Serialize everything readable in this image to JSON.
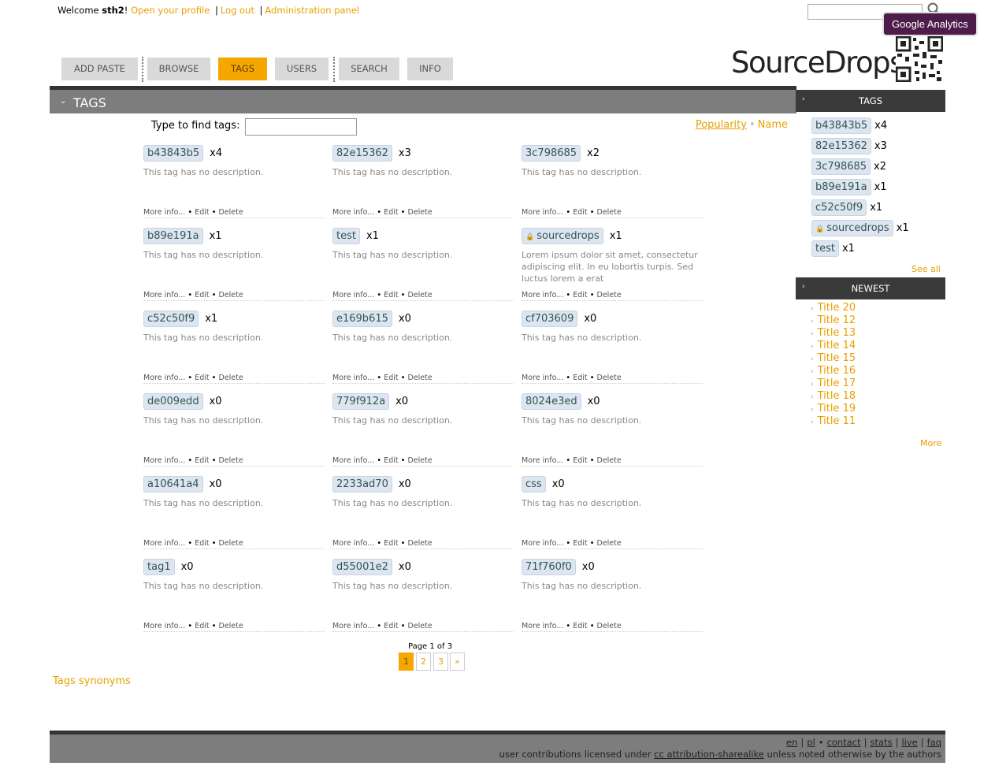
{
  "topbar": {
    "welcome": "Welcome",
    "username": "sth2",
    "exclaim": "!",
    "open_profile": "Open your profile",
    "logout": "Log out",
    "admin": "Administration panel",
    "separator": "|"
  },
  "search": {
    "placeholder": ""
  },
  "ga_badge": "Google Analytics",
  "nav": [
    {
      "label": "ADD PASTE"
    },
    {
      "label": "BROWSE"
    },
    {
      "label": "TAGS",
      "active": true
    },
    {
      "label": "USERS"
    },
    {
      "label": "SEARCH"
    },
    {
      "label": "INFO"
    }
  ],
  "logo": "SourceDrops",
  "main": {
    "title": "TAGS",
    "find_label": "Type to find tags:",
    "sort": {
      "popularity": "Popularity",
      "sep": "•",
      "name": "Name"
    },
    "default_desc": "This tag has no description.",
    "actions": {
      "more": "More info...",
      "edit": "Edit",
      "delete": "Delete",
      "bullet": "•"
    },
    "tags": [
      {
        "name": "b43843b5",
        "count": "x4",
        "desc": "This tag has no description."
      },
      {
        "name": "82e15362",
        "count": "x3",
        "desc": "This tag has no description."
      },
      {
        "name": "3c798685",
        "count": "x2",
        "desc": "This tag has no description."
      },
      {
        "name": "b89e191a",
        "count": "x1",
        "desc": "This tag has no description."
      },
      {
        "name": "test",
        "count": "x1",
        "desc": "This tag has no description."
      },
      {
        "name": "sourcedrops",
        "count": "x1",
        "locked": true,
        "desc": "Lorem ipsum dolor sit amet, consectetur adipiscing elit. In eu lobortis turpis. Sed luctus lorem a erat"
      },
      {
        "name": "c52c50f9",
        "count": "x1",
        "desc": "This tag has no description."
      },
      {
        "name": "e169b615",
        "count": "x0",
        "desc": "This tag has no description."
      },
      {
        "name": "cf703609",
        "count": "x0",
        "desc": "This tag has no description."
      },
      {
        "name": "de009edd",
        "count": "x0",
        "desc": "This tag has no description."
      },
      {
        "name": "779f912a",
        "count": "x0",
        "desc": "This tag has no description."
      },
      {
        "name": "8024e3ed",
        "count": "x0",
        "desc": "This tag has no description."
      },
      {
        "name": "a10641a4",
        "count": "x0",
        "desc": "This tag has no description."
      },
      {
        "name": "2233ad70",
        "count": "x0",
        "desc": "This tag has no description."
      },
      {
        "name": "css",
        "count": "x0",
        "desc": "This tag has no description."
      },
      {
        "name": "tag1",
        "count": "x0",
        "desc": "This tag has no description."
      },
      {
        "name": "d55001e2",
        "count": "x0",
        "desc": "This tag has no description."
      },
      {
        "name": "71f760f0",
        "count": "x0",
        "desc": "This tag has no description."
      }
    ],
    "pagination": {
      "label": "Page 1 of 3",
      "pages": [
        "1",
        "2",
        "3",
        "»"
      ],
      "current": "1"
    },
    "synonyms": "Tags synonyms"
  },
  "sidebar": {
    "tags_title": "TAGS",
    "tags": [
      {
        "name": "b43843b5",
        "count": "x4"
      },
      {
        "name": "82e15362",
        "count": "x3"
      },
      {
        "name": "3c798685",
        "count": "x2"
      },
      {
        "name": "b89e191a",
        "count": "x1"
      },
      {
        "name": "c52c50f9",
        "count": "x1"
      },
      {
        "name": "sourcedrops",
        "count": "x1",
        "locked": true
      },
      {
        "name": "test",
        "count": "x1"
      }
    ],
    "see_all": "See all",
    "newest_title": "NEWEST",
    "newest": [
      "Title 20",
      "Title 12",
      "Title 13",
      "Title 14",
      "Title 15",
      "Title 16",
      "Title 17",
      "Title 18",
      "Title 19",
      "Title 11"
    ],
    "more": "More"
  },
  "footer": {
    "links": [
      "en",
      "pl",
      "contact",
      "stats",
      "live",
      "faq"
    ],
    "license_prefix": "user contributions licensed under",
    "license_link": "cc attribution-sharealike",
    "license_suffix": "unless noted otherwise by the authors"
  },
  "colors": {
    "accent": "#f5a700",
    "link": "#e8a000",
    "header": "#7d7d7d",
    "dark": "#3a3a3a",
    "ga": "#4d1c4a"
  }
}
